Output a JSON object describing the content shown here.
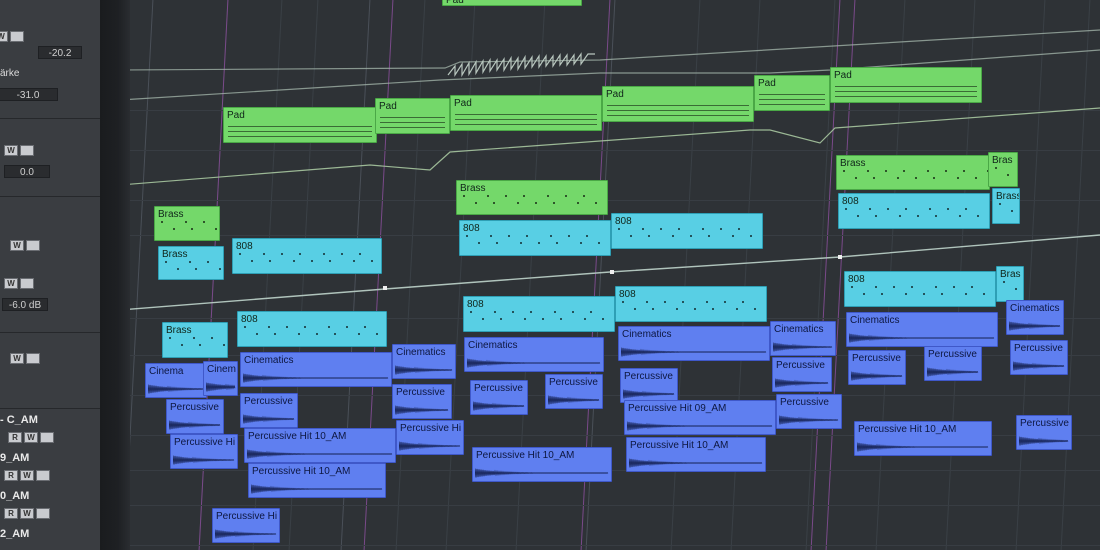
{
  "panel": {
    "value_top": "-20.2",
    "label_staerke": "ärke",
    "value_staerke": "-31.0",
    "value_zero": "0.0",
    "value_db": "-6.0 dB",
    "btn_r": "R",
    "btn_w": "W",
    "tracks": [
      "- C_AM",
      "9_AM",
      "0_AM",
      "2_AM"
    ]
  },
  "clips": {
    "pad": "Pad",
    "brass": "Brass",
    "c808": "808",
    "cinematics": "Cinematics",
    "percussive": "Percussive",
    "ph": "Percussive Hi",
    "ph09": "Percussive Hit 09_AM",
    "ph10": "Percussive Hit 10_AM",
    "cinema": "Cinema",
    "cinem": "Cinem",
    "bras": "Bras",
    "brass_short": "Brass"
  },
  "colors": {
    "green": "#74d86a",
    "cyan": "#58cfe4",
    "blue": "#5f7ff0",
    "marker": "#7a4a8a"
  }
}
